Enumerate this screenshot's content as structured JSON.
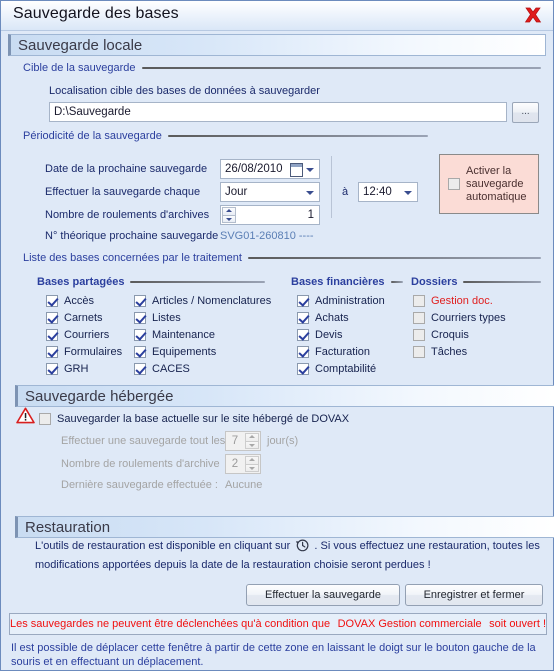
{
  "window": {
    "title": "Sauvegarde des bases",
    "close_icon": "close-x-icon"
  },
  "local": {
    "header": "Sauvegarde locale",
    "target_group": "Cible de la sauvegarde",
    "target_label": "Localisation cible des bases de données à sauvegarder",
    "target_value": "D:\\Sauvegarde",
    "browse_label": "...",
    "periodicity_group": "Périodicité de la sauvegarde",
    "next_date_label": "Date de la prochaine sauvegarde",
    "next_date_value": "26/08/2010",
    "each_label": "Effectuer la sauvegarde chaque",
    "each_value": "Jour",
    "at_label": "à",
    "at_value": "12:40",
    "rolls_label": "Nombre de roulements d'archives",
    "rolls_value": "1",
    "theoretical_label": "N° théorique prochaine sauvegarde",
    "theoretical_value": "SVG01-260810 ----",
    "auto_label_line1": "Activer la",
    "auto_label_line2": "sauvegarde",
    "auto_label_line3": "automatique",
    "auto_checked": false
  },
  "databases": {
    "group_title": "Liste des bases concernées par le traitement",
    "columns": [
      {
        "title": "Bases partagées",
        "items": [
          {
            "label": "Accès",
            "checked": true,
            "red": false
          },
          {
            "label": "Carnets",
            "checked": true,
            "red": false
          },
          {
            "label": "Courriers",
            "checked": true,
            "red": false
          },
          {
            "label": "Formulaires",
            "checked": true,
            "red": false
          },
          {
            "label": "GRH",
            "checked": true,
            "red": false
          }
        ]
      },
      {
        "title": "",
        "items": [
          {
            "label": "Articles / Nomenclatures",
            "checked": true,
            "red": false
          },
          {
            "label": "Listes",
            "checked": true,
            "red": false
          },
          {
            "label": "Maintenance",
            "checked": true,
            "red": false
          },
          {
            "label": "Equipements",
            "checked": true,
            "red": false
          },
          {
            "label": "CACES",
            "checked": true,
            "red": false
          }
        ]
      },
      {
        "title": "Bases financières",
        "items": [
          {
            "label": "Administration",
            "checked": true,
            "red": false
          },
          {
            "label": "Achats",
            "checked": true,
            "red": false
          },
          {
            "label": "Devis",
            "checked": true,
            "red": false
          },
          {
            "label": "Facturation",
            "checked": true,
            "red": false
          },
          {
            "label": "Comptabilité",
            "checked": true,
            "red": false
          }
        ]
      },
      {
        "title": "Dossiers",
        "items": [
          {
            "label": "Gestion doc.",
            "checked": false,
            "red": true
          },
          {
            "label": "Courriers types",
            "checked": false,
            "red": false
          },
          {
            "label": "Croquis",
            "checked": false,
            "red": false
          },
          {
            "label": "Tâches",
            "checked": false,
            "red": false
          }
        ]
      }
    ]
  },
  "hosted": {
    "header": "Sauvegarde hébergée",
    "warning_icon": "warning-triangle-icon",
    "enable_label": "Sauvegarder la base actuelle sur le site hébergé de DOVAX",
    "enable_checked": false,
    "every_label": "Effectuer une sauvegarde tout les",
    "every_value": "7",
    "days_label": "jour(s)",
    "rolls_label": "Nombre de roulements d'archive",
    "rolls_value": "2",
    "last_label": "Dernière sauvegarde effectuée :",
    "last_value": "Aucune"
  },
  "restore": {
    "header": "Restauration",
    "text_before": "L'outils de restauration est disponible en cliquant sur",
    "clock_icon": "restore-clock-icon",
    "text_after": ". Si vous effectuez une restauration, toutes les",
    "text_line2": "modifications apportées depuis la date de la restauration choisie seront perdues !"
  },
  "actions": {
    "backup_label": "Effectuer la sauvegarde",
    "save_close_label": "Enregistrer et fermer"
  },
  "footer": {
    "warning_part1": "Les sauvegardes ne peuvent être déclenchées qu'à condition que",
    "warning_part2": "DOVAX Gestion commerciale",
    "warning_part3": "soit ouvert !",
    "move_hint_line1": "Il est possible de déplacer cette fenêtre à partir de cette zone en laissant le doigt sur le bouton gauche de la souris",
    "move_hint_line2": "et en effectuant un déplacement."
  },
  "colors": {
    "background": "#dfe9f7",
    "accent_blue": "#2b3f9e",
    "warning_red": "#f01010",
    "auto_panel": "#fbdcd6"
  }
}
